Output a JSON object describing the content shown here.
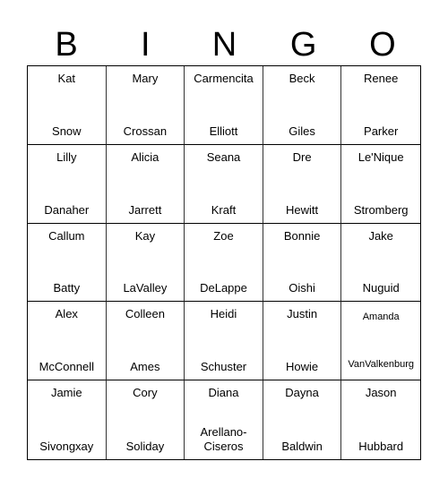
{
  "header": [
    "B",
    "I",
    "N",
    "G",
    "O"
  ],
  "cells": [
    {
      "first": "Kat",
      "last": "Snow"
    },
    {
      "first": "Mary",
      "last": "Crossan"
    },
    {
      "first": "Carmencita",
      "last": "Elliott"
    },
    {
      "first": "Beck",
      "last": "Giles"
    },
    {
      "first": "Renee",
      "last": "Parker"
    },
    {
      "first": "Lilly",
      "last": "Danaher"
    },
    {
      "first": "Alicia",
      "last": "Jarrett"
    },
    {
      "first": "Seana",
      "last": "Kraft"
    },
    {
      "first": "Dre",
      "last": "Hewitt"
    },
    {
      "first": "Le'Nique",
      "last": "Stromberg"
    },
    {
      "first": "Callum",
      "last": "Batty"
    },
    {
      "first": "Kay",
      "last": "LaValley"
    },
    {
      "first": "Zoe",
      "last": "DeLappe"
    },
    {
      "first": "Bonnie",
      "last": "Oishi"
    },
    {
      "first": "Jake",
      "last": "Nuguid"
    },
    {
      "first": "Alex",
      "last": "McConnell"
    },
    {
      "first": "Colleen",
      "last": "Ames"
    },
    {
      "first": "Heidi",
      "last": "Schuster"
    },
    {
      "first": "Justin",
      "last": "Howie"
    },
    {
      "first": "Amanda",
      "last": "VanValkenburg"
    },
    {
      "first": "Jamie",
      "last": "Sivongxay"
    },
    {
      "first": "Cory",
      "last": "Soliday"
    },
    {
      "first": "Diana",
      "last": "Arellano-\nCiseros"
    },
    {
      "first": "Dayna",
      "last": "Baldwin"
    },
    {
      "first": "Jason",
      "last": "Hubbard"
    }
  ]
}
